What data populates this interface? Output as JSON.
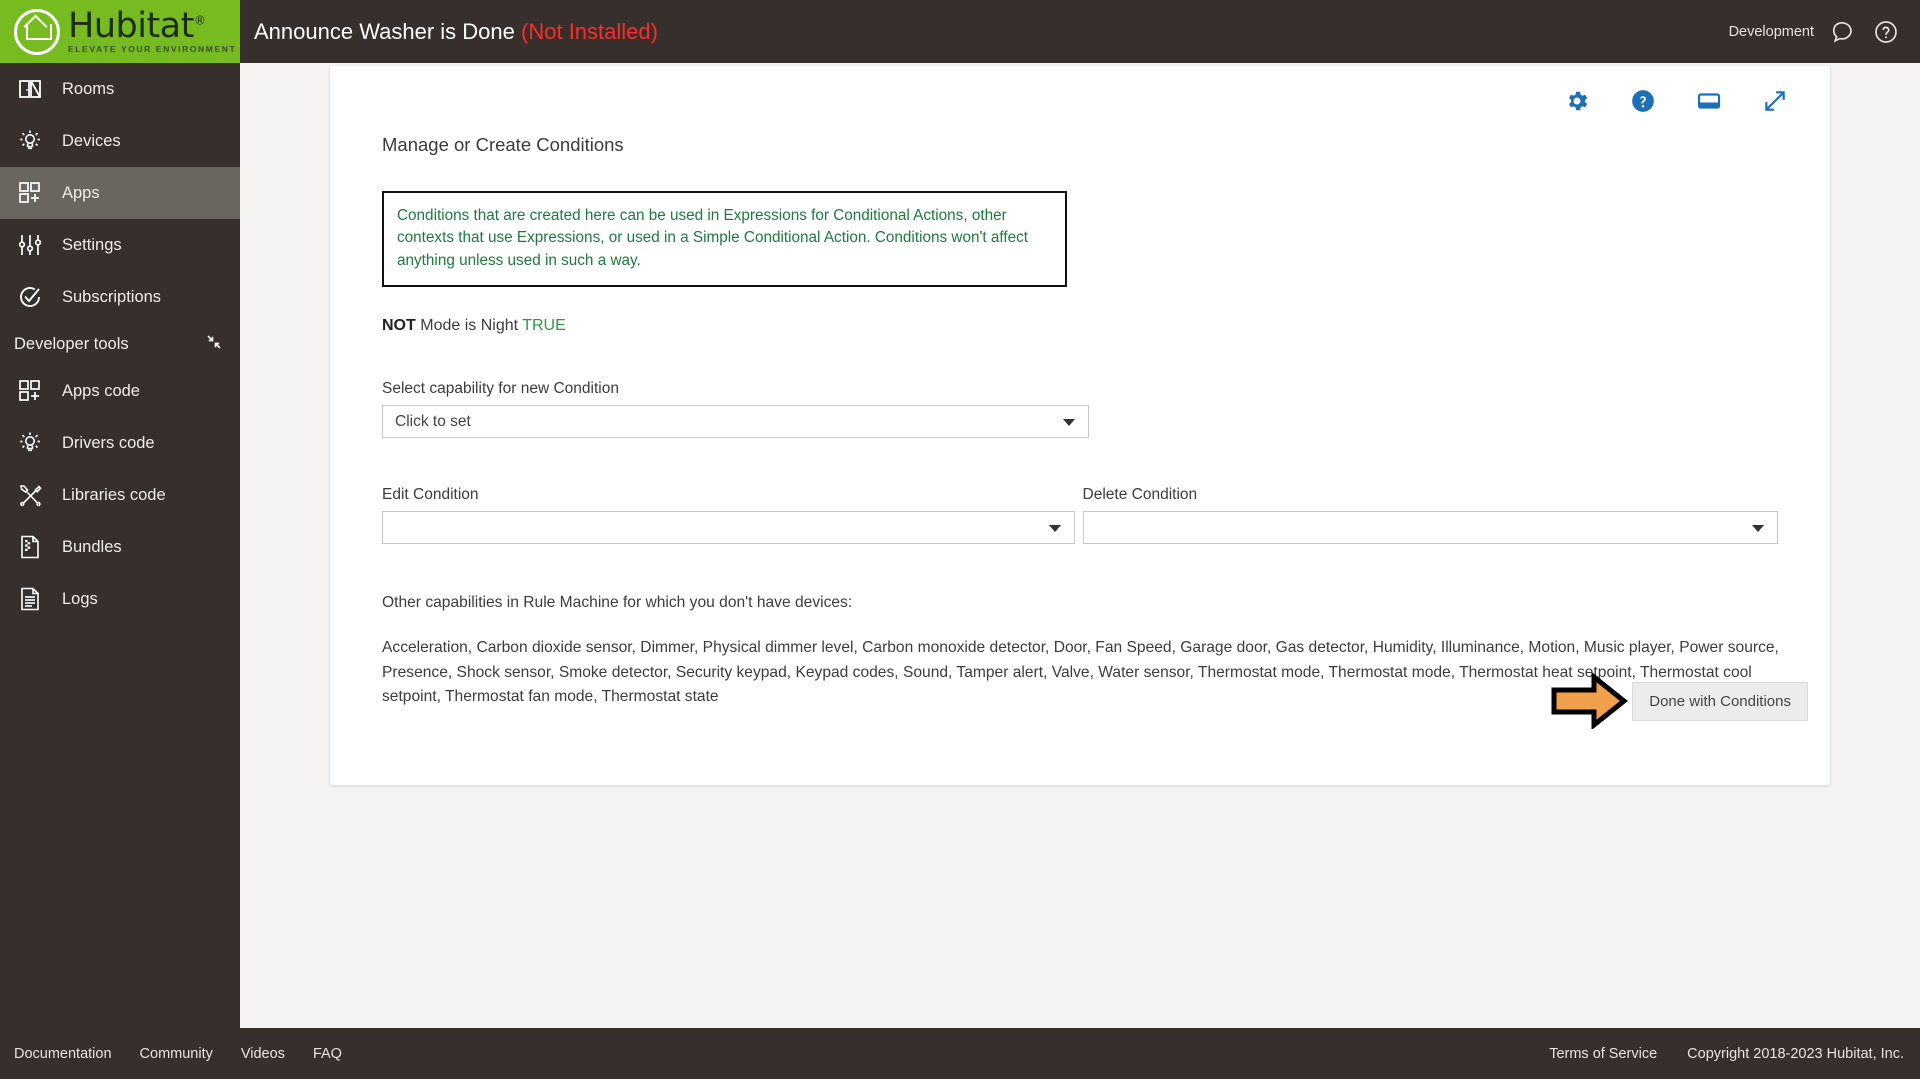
{
  "brand": {
    "name": "Hubitat",
    "tagline": "ELEVATE YOUR ENVIRONMENT",
    "registered": "®",
    "green": "#76bc21"
  },
  "header": {
    "title": "Announce Washer is Done",
    "status": "(Not Installed)",
    "status_color": "#ff2b2b",
    "environment": "Development",
    "icons": [
      "chat-bubble-icon",
      "help-circle-icon"
    ]
  },
  "sidebar": {
    "items": [
      {
        "label": "Rooms",
        "icon": "rooms-icon",
        "active": false
      },
      {
        "label": "Devices",
        "icon": "devices-bulb-icon",
        "active": false
      },
      {
        "label": "Apps",
        "icon": "apps-grid-icon",
        "active": true
      },
      {
        "label": "Settings",
        "icon": "settings-sliders-icon",
        "active": false
      },
      {
        "label": "Subscriptions",
        "icon": "subscriptions-check-icon",
        "active": false
      }
    ],
    "section": {
      "label": "Developer tools",
      "collapse_icon": "collapse-arrows-icon"
    },
    "dev_items": [
      {
        "label": "Apps code",
        "icon": "apps-grid-icon"
      },
      {
        "label": "Drivers code",
        "icon": "devices-bulb-icon"
      },
      {
        "label": "Libraries code",
        "icon": "tools-icon"
      },
      {
        "label": "Bundles",
        "icon": "zip-file-icon"
      },
      {
        "label": "Logs",
        "icon": "document-lines-icon"
      }
    ]
  },
  "card": {
    "icons": [
      "gear-icon",
      "help-circle-icon",
      "window-icon",
      "expand-arrows-icon"
    ],
    "icon_color": "#1d6fb8",
    "heading": "Manage or Create Conditions",
    "info_box": {
      "text": "Conditions that are created here can be used in Expressions for Conditional Actions, other contexts that use Expressions, or used in a Simple Conditional Action.  Conditions won't affect anything unless used in such a way.",
      "text_color": "#1f7a3d",
      "border_color": "#111111"
    },
    "condition": {
      "keyword": "NOT",
      "statement": "Mode is Night",
      "value": "TRUE",
      "value_color": "#2a9b3f"
    },
    "capability_select": {
      "label": "Select capability for new Condition",
      "value": "Click to set"
    },
    "edit_condition": {
      "label": "Edit Condition",
      "value": ""
    },
    "delete_condition": {
      "label": "Delete Condition",
      "value": ""
    },
    "other_capabilities": {
      "title": "Other capabilities in Rule Machine for which you don't have devices:",
      "list": "Acceleration, Carbon dioxide sensor, Dimmer, Physical dimmer level, Carbon monoxide detector, Door, Fan Speed, Garage door, Gas detector, Humidity, Illuminance, Motion, Music player, Power source, Presence, Shock sensor, Smoke detector, Security keypad, Keypad codes, Sound, Tamper alert, Valve, Water sensor, Thermostat mode, Thermostat mode, Thermostat heat setpoint, Thermostat cool setpoint, Thermostat fan mode, Thermostat state"
    },
    "done_button": "Done with Conditions",
    "annotation": {
      "icon": "orange-right-arrow-annotation",
      "fill": "#f0a04b",
      "stroke": "#000000"
    }
  },
  "footer": {
    "links": [
      "Documentation",
      "Community",
      "Videos",
      "FAQ"
    ],
    "terms": "Terms of Service",
    "copyright": "Copyright 2018-2023 Hubitat, Inc."
  }
}
